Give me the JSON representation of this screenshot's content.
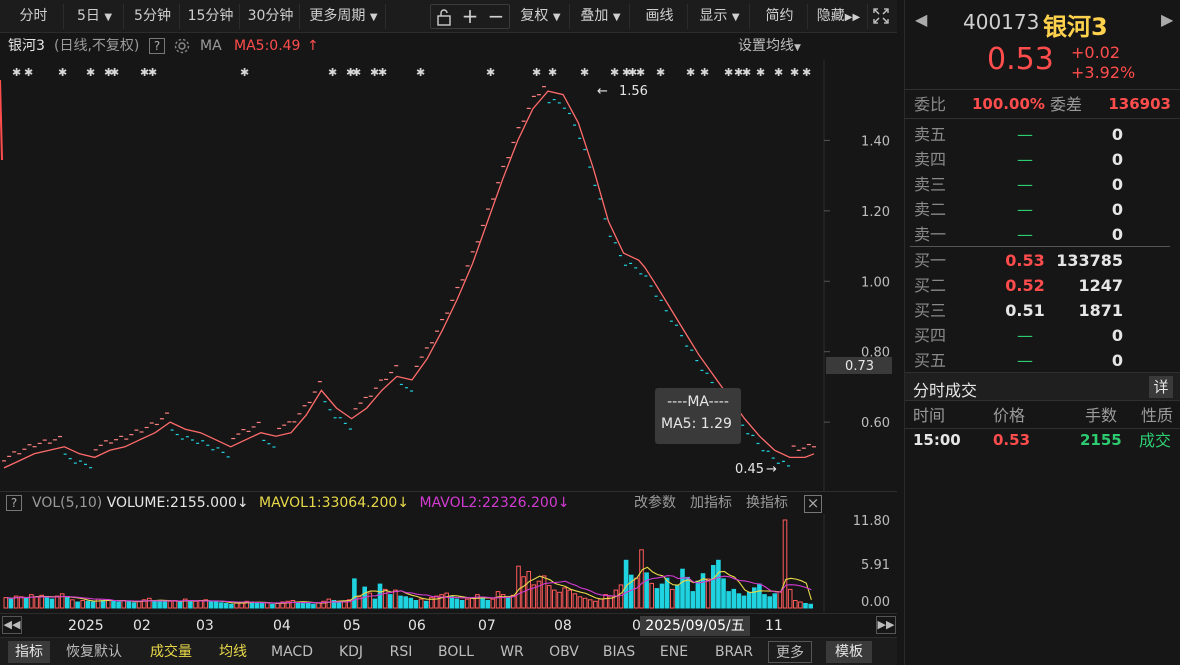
{
  "toolbar": {
    "items": [
      "分时",
      "5日",
      "5分钟",
      "15分钟",
      "30分钟",
      "更多周期"
    ],
    "right_items": [
      "复权",
      "叠加",
      "画线",
      "显示",
      "简约",
      "隐藏"
    ]
  },
  "chart_header": {
    "name": "银河3",
    "mode": "(日线,不复权)",
    "help": "?",
    "ma_label": "MA",
    "ma5_label": "MA5:0.49",
    "ma5_arrow": "↑",
    "settings": "设置均线"
  },
  "price_axis": {
    "ticks": [
      "1.40",
      "1.20",
      "1.00",
      "0.80",
      "0.60"
    ],
    "current": "0.73",
    "high_label": "1.56",
    "low_label": "0.45"
  },
  "tooltip": {
    "title": "----MA----",
    "value": "MA5: 1.29"
  },
  "volume_header": {
    "help": "?",
    "vol": "VOL(5,10)",
    "volume": "VOLUME:2155.000",
    "mavol1": "MAVOL1:33064.200",
    "mavol2": "MAVOL2:22326.200",
    "arrow": "↓",
    "edit_params": "改参数",
    "add_indicator": "加指标",
    "switch_indicator": "换指标",
    "close": "×"
  },
  "volume_axis": {
    "ticks": [
      "11.80",
      "5.91",
      "0.00"
    ]
  },
  "time_axis": {
    "labels": [
      "2025",
      "02",
      "03",
      "04",
      "05",
      "06",
      "07",
      "08",
      "0",
      "11"
    ],
    "cursor_date": "2025/09/05/五"
  },
  "bottom_tabs": [
    "指标",
    "恢复默认",
    "成交量",
    "均线",
    "MACD",
    "KDJ",
    "RSI",
    "BOLL",
    "WR",
    "OBV",
    "BIAS",
    "ENE",
    "BRAR",
    "更多",
    "模板"
  ],
  "quote": {
    "code": "400173",
    "name": "银河3",
    "price": "0.53",
    "change": "+0.02",
    "change_pct": "+3.92%",
    "weibi_label": "委比",
    "weibi": "100.00%",
    "weicha_label": "委差",
    "weicha": "136903",
    "asks": [
      {
        "label": "卖五",
        "price": "—",
        "vol": "0"
      },
      {
        "label": "卖四",
        "price": "—",
        "vol": "0"
      },
      {
        "label": "卖三",
        "price": "—",
        "vol": "0"
      },
      {
        "label": "卖二",
        "price": "—",
        "vol": "0"
      },
      {
        "label": "卖一",
        "price": "—",
        "vol": "0"
      }
    ],
    "bids": [
      {
        "label": "买一",
        "price": "0.53",
        "vol": "133785"
      },
      {
        "label": "买二",
        "price": "0.52",
        "vol": "1247"
      },
      {
        "label": "买三",
        "price": "0.51",
        "vol": "1871"
      },
      {
        "label": "买四",
        "price": "—",
        "vol": "0"
      },
      {
        "label": "买五",
        "price": "—",
        "vol": "0"
      }
    ],
    "trades_title": "分时成交",
    "trades_detail": "详",
    "trades_headers": [
      "时间",
      "价格",
      "手数",
      "性质"
    ],
    "trades": [
      {
        "time": "15:00",
        "price": "0.53",
        "vol": "2155",
        "type": "成交"
      }
    ]
  },
  "colors": {
    "up": "#ff4d4d",
    "down": "#2ecc71",
    "ma5": "#ff6b6b",
    "cyan": "#1fd3e0",
    "yellow": "#e8d94a",
    "magenta": "#d23bd2"
  },
  "chart_data": {
    "type": "line",
    "series": [
      {
        "name": "MA5",
        "x": [
          0,
          5,
          10,
          15,
          20,
          25,
          30,
          35,
          40,
          45,
          50,
          55,
          60,
          65,
          70,
          75,
          80,
          85,
          90,
          95,
          100,
          105,
          110,
          115,
          120,
          125,
          130,
          135,
          140,
          145,
          150,
          155,
          160,
          165,
          170,
          175,
          180,
          185,
          190,
          195,
          200,
          205,
          210,
          212,
          215,
          220,
          225,
          230,
          235,
          240,
          245,
          250,
          255,
          260,
          265,
          268
        ],
        "y": [
          0.47,
          0.49,
          0.51,
          0.52,
          0.53,
          0.51,
          0.5,
          0.52,
          0.53,
          0.55,
          0.57,
          0.6,
          0.58,
          0.57,
          0.55,
          0.53,
          0.55,
          0.57,
          0.56,
          0.57,
          0.62,
          0.69,
          0.64,
          0.61,
          0.64,
          0.69,
          0.73,
          0.72,
          0.78,
          0.86,
          0.95,
          1.05,
          1.17,
          1.29,
          1.4,
          1.49,
          1.54,
          1.53,
          1.45,
          1.32,
          1.17,
          1.08,
          1.06,
          1.04,
          1.0,
          0.93,
          0.86,
          0.79,
          0.73,
          0.67,
          0.61,
          0.56,
          0.52,
          0.5,
          0.5,
          0.51
        ]
      }
    ],
    "ylim": [
      0.43,
      1.6
    ],
    "volume": {
      "mavol1_label": "MAVOL1",
      "mavol2_label": "MAVOL2",
      "values": [
        1.4,
        1.2,
        1.6,
        1.5,
        1.3,
        1.8,
        1.5,
        1.7,
        1.4,
        1.2,
        1.6,
        1.9,
        1.4,
        1.1,
        0.8,
        1.0,
        0.9,
        0.8,
        1.2,
        1.0,
        1.1,
        0.9,
        0.8,
        1.0,
        0.9,
        0.7,
        0.9,
        1.1,
        1.3,
        1.0,
        0.9,
        0.8,
        0.9,
        1.0,
        0.9,
        1.2,
        0.8,
        0.9,
        1.0,
        1.1,
        0.9,
        0.8,
        0.7,
        0.6,
        0.5,
        0.7,
        0.8,
        0.9,
        0.8,
        0.7,
        0.6,
        0.7,
        0.5,
        0.6,
        0.8,
        0.9,
        1.0,
        0.8,
        0.7,
        0.6,
        0.5,
        0.7,
        0.9,
        1.2,
        1.0,
        0.8,
        0.9,
        1.1,
        3.9,
        1.5,
        2.8,
        2.0,
        1.2,
        3.2,
        2.5,
        1.8,
        2.4,
        1.6,
        1.5,
        1.3,
        1.0,
        1.2,
        0.9,
        1.4,
        1.6,
        1.8,
        2.0,
        1.5,
        1.2,
        1.0,
        1.2,
        1.4,
        1.8,
        1.3,
        1.0,
        1.2,
        2.2,
        1.8,
        1.5,
        1.7,
        5.6,
        4.2,
        4.9,
        3.1,
        3.6,
        4.3,
        3.0,
        2.4,
        2.1,
        2.7,
        2.4,
        1.9,
        1.5,
        1.3,
        1.1,
        0.9,
        1.2,
        1.8,
        1.6,
        2.4,
        3.1,
        6.4,
        4.4,
        4.0,
        7.8,
        4.7,
        3.3,
        2.6,
        3.2,
        4.0,
        2.5,
        3.0,
        5.2,
        4.1,
        2.2,
        3.6,
        4.6,
        3.9,
        5.7,
        6.4,
        3.9,
        2.2,
        2.5,
        1.9,
        1.6,
        2.1,
        2.7,
        3.2,
        1.8,
        1.5,
        1.9,
        2.2,
        11.8,
        2.5,
        1.0,
        0.8,
        0.6,
        0.5
      ],
      "up": [
        1,
        0,
        1,
        1,
        0,
        1,
        1,
        1,
        0,
        0,
        1,
        1,
        0,
        1,
        0,
        1,
        0,
        0,
        1,
        0,
        1,
        0,
        0,
        1,
        0,
        0,
        1,
        1,
        1,
        0,
        0,
        0,
        1,
        1,
        0,
        1,
        0,
        1,
        1,
        1,
        0,
        0,
        0,
        0,
        0,
        1,
        1,
        1,
        0,
        0,
        0,
        1,
        0,
        1,
        1,
        1,
        1,
        0,
        0,
        0,
        0,
        1,
        1,
        1,
        0,
        0,
        1,
        1,
        0,
        1,
        0,
        1,
        0,
        0,
        1,
        0,
        1,
        0,
        0,
        0,
        0,
        1,
        0,
        1,
        1,
        1,
        1,
        0,
        0,
        0,
        1,
        1,
        1,
        0,
        0,
        1,
        1,
        1,
        0,
        1,
        1,
        1,
        1,
        1,
        1,
        1,
        1,
        1,
        1,
        1,
        1,
        1,
        1,
        1,
        1,
        1,
        1,
        1,
        1,
        1,
        1,
        0,
        0,
        1,
        1,
        0,
        1,
        0,
        0,
        0,
        1,
        0,
        0,
        0,
        0,
        0,
        0,
        1,
        0,
        0,
        0,
        0,
        0,
        0,
        0,
        0,
        0,
        0,
        0,
        0,
        0,
        1,
        1,
        1,
        1,
        1
      ]
    }
  }
}
